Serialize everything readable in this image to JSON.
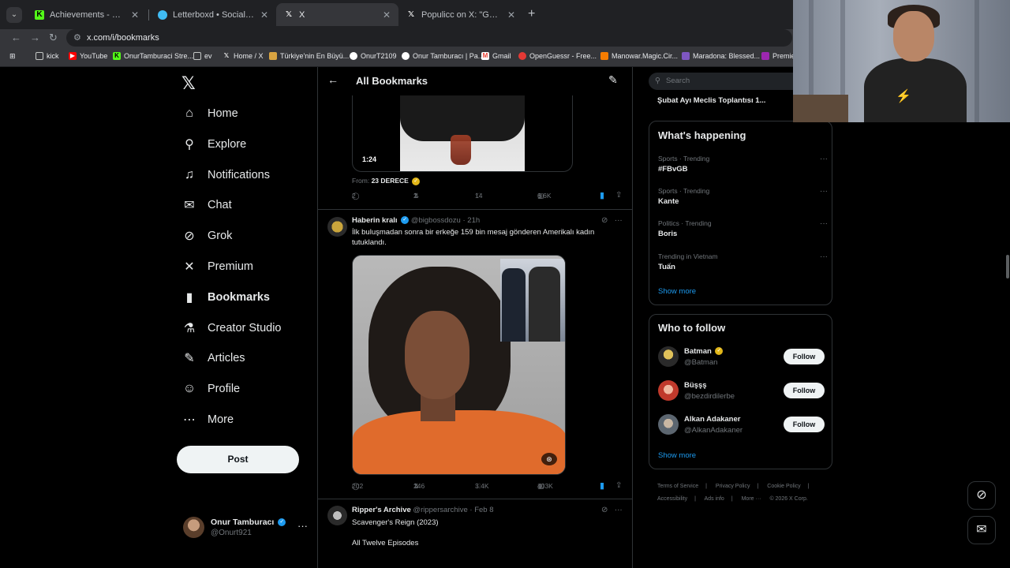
{
  "browser": {
    "tabs": [
      {
        "label": "Achievements - Kick Dashboard",
        "icon": "kick-icon",
        "color": "#53fc18"
      },
      {
        "label": "Letterboxd • Social film discove",
        "icon": "letterboxd-icon",
        "color": "#40bcf4"
      },
      {
        "label": "X",
        "icon": "x-icon",
        "color": "#ffffff"
      },
      {
        "label": "Populicc on X: \"Gündüz kuşağı",
        "icon": "x-icon",
        "color": "#ffffff"
      }
    ],
    "url": "x.com/i/bookmarks",
    "bookmarks": [
      {
        "label": "kick",
        "icon": "folder-icon"
      },
      {
        "label": "YouTube",
        "icon": "youtube-icon"
      },
      {
        "label": "OnurTamburaci Stre...",
        "icon": "kick-icon"
      },
      {
        "label": "ev",
        "icon": "folder-icon"
      },
      {
        "label": "Home / X",
        "icon": "x-icon"
      },
      {
        "label": "Türkiye'nin En Büyü...",
        "icon": "site-icon"
      },
      {
        "label": "OnurT2109",
        "icon": "site-icon"
      },
      {
        "label": "Onur Tamburacı | Pa...",
        "icon": "site-icon"
      },
      {
        "label": "Gmail",
        "icon": "gmail-icon"
      },
      {
        "label": "OpenGuessr - Free...",
        "icon": "site-icon"
      },
      {
        "label": "Manowar.Magic.Cir...",
        "icon": "site-icon"
      },
      {
        "label": "Maradona: Blessed...",
        "icon": "site-icon"
      },
      {
        "label": "Premie",
        "icon": "site-icon"
      }
    ]
  },
  "nav": {
    "items": [
      {
        "label": "Home",
        "icon": "home-icon",
        "glyph": "⌂"
      },
      {
        "label": "Explore",
        "icon": "search-icon",
        "glyph": "⚲"
      },
      {
        "label": "Notifications",
        "icon": "bell-icon",
        "glyph": "🔔"
      },
      {
        "label": "Chat",
        "icon": "mail-icon",
        "glyph": "✉"
      },
      {
        "label": "Grok",
        "icon": "grok-icon",
        "glyph": "⊘"
      },
      {
        "label": "Premium",
        "icon": "x-icon",
        "glyph": "𝕏"
      },
      {
        "label": "Bookmarks",
        "icon": "bookmark-icon",
        "glyph": "🔖"
      },
      {
        "label": "Creator Studio",
        "icon": "flask-icon",
        "glyph": "⚗"
      },
      {
        "label": "Articles",
        "icon": "article-icon",
        "glyph": "✎"
      },
      {
        "label": "Profile",
        "icon": "person-icon",
        "glyph": "☺"
      },
      {
        "label": "More",
        "icon": "more-icon",
        "glyph": "⋯"
      }
    ],
    "post_label": "Post",
    "account": {
      "name": "Onur Tamburacı",
      "handle": "@Onurt921"
    }
  },
  "timeline": {
    "title": "All Bookmarks",
    "tweet1": {
      "duration": "1:24",
      "from_prefix": "From:",
      "from_name": "23 DERECE",
      "replies": "2",
      "reposts": "2",
      "likes": "14",
      "views": "6.6K"
    },
    "tweet2": {
      "name": "Haberin kralı",
      "handle": "@bigbossdozu",
      "time": "21h",
      "text": "İlk buluşmadan sonra bir erkeğe 159 bin mesaj gönderen Amerikalı kadın tutuklandı.",
      "replies": "202",
      "reposts": "246",
      "likes": "3.4K",
      "views": "403K"
    },
    "tweet3": {
      "name": "Ripper's Archive",
      "handle": "@rippersarchive",
      "time": "Feb 8",
      "line1": "Scavenger's Reign (2023)",
      "line2": "All Twelve Episodes"
    }
  },
  "sidebar": {
    "search_placeholder": "Search",
    "trend_top": "Şubat Ayı Meclis Toplantısı 1...",
    "happening_title": "What's happening",
    "trends": [
      {
        "category": "Sports · Trending",
        "name": "#FBvGB"
      },
      {
        "category": "Sports · Trending",
        "name": "Kante"
      },
      {
        "category": "Politics · Trending",
        "name": "Boris"
      },
      {
        "category": "Trending in Vietnam",
        "name": "Tuấn"
      }
    ],
    "show_more": "Show more",
    "who_title": "Who to follow",
    "follow_label": "Follow",
    "who": [
      {
        "name": "Batman",
        "handle": "@Batman"
      },
      {
        "name": "Büşşş",
        "handle": "@bezdirdilerbe"
      },
      {
        "name": "Alkan Adakaner",
        "handle": "@AlkanAdakaner"
      }
    ],
    "footer": [
      "Terms of Service",
      "|",
      "Privacy Policy",
      "|",
      "Cookie Policy",
      "|",
      "Accessibility",
      "|",
      "Ads info",
      "|",
      "More ···",
      "© 2026 X Corp."
    ]
  },
  "colors": {
    "accent": "#1d9bf0",
    "background": "#000000",
    "border": "#2f3336",
    "muted": "#71767b"
  }
}
